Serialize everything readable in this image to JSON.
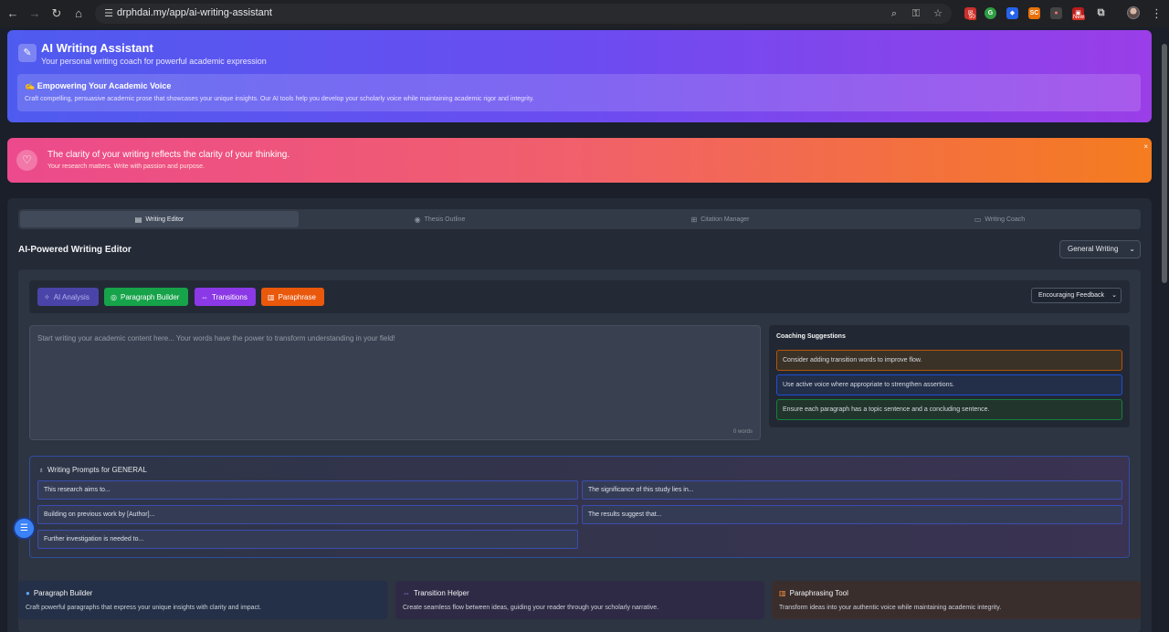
{
  "browser": {
    "url": "drphdai.my/app/ai-writing-assistant",
    "extension_badges": [
      "50",
      "New"
    ]
  },
  "hero": {
    "title": "AI Writing Assistant",
    "subtitle": "Your personal writing coach for powerful academic expression",
    "box_title": "✍️ Empowering Your Academic Voice",
    "box_text": "Craft compelling, persuasive academic prose that showcases your unique insights. Our AI tools help you develop your scholarly voice while maintaining academic rigor and integrity."
  },
  "banner": {
    "title": "The clarity of your writing reflects the clarity of your thinking.",
    "subtitle": "Your research matters. Write with passion and purpose.",
    "close": "×"
  },
  "tabs": [
    {
      "label": "Writing Editor",
      "icon": "document-icon",
      "active": true
    },
    {
      "label": "Thesis Outline",
      "icon": "target-icon",
      "active": false
    },
    {
      "label": "Citation Manager",
      "icon": "book-icon",
      "active": false
    },
    {
      "label": "Writing Coach",
      "icon": "chat-icon",
      "active": false
    }
  ],
  "editor": {
    "title": "AI-Powered Writing Editor",
    "mode_select": "General Writing",
    "toolbar": {
      "analysis": "AI Analysis",
      "paragraph_builder": "Paragraph Builder",
      "transitions": "Transitions",
      "paraphrase": "Paraphrase",
      "feedback_select": "Encouraging Feedback"
    },
    "placeholder": "Start writing your academic content here... Your words have the power to transform understanding in your field!",
    "word_count": "0 words"
  },
  "coaching": {
    "title": "Coaching Suggestions",
    "items": [
      "Consider adding transition words to improve flow.",
      "Use active voice where appropriate to strengthen assertions.",
      "Ensure each paragraph has a topic sentence and a concluding sentence."
    ]
  },
  "prompts": {
    "title": "Writing Prompts for GENERAL",
    "items": [
      "This research aims to...",
      "The significance of this study lies in...",
      "Building on previous work by [Author]...",
      "The results suggest that...",
      "Further investigation is needed to..."
    ]
  },
  "cards": [
    {
      "title": "Paragraph Builder",
      "text": "Craft powerful paragraphs that express your unique insights with clarity and impact."
    },
    {
      "title": "Transition Helper",
      "text": "Create seamless flow between ideas, guiding your reader through your scholarly narrative."
    },
    {
      "title": "Paraphrasing Tool",
      "text": "Transform ideas into your authentic voice while maintaining academic integrity."
    }
  ],
  "colors": {
    "hero_start": "#4f5bef",
    "hero_end": "#9a3ee8",
    "banner_start": "#ec4a8c",
    "banner_end": "#f57c1f",
    "paragraph_green": "#16a34a",
    "transitions_purple": "#8b39e6",
    "paraphrase_orange": "#ea580c"
  }
}
